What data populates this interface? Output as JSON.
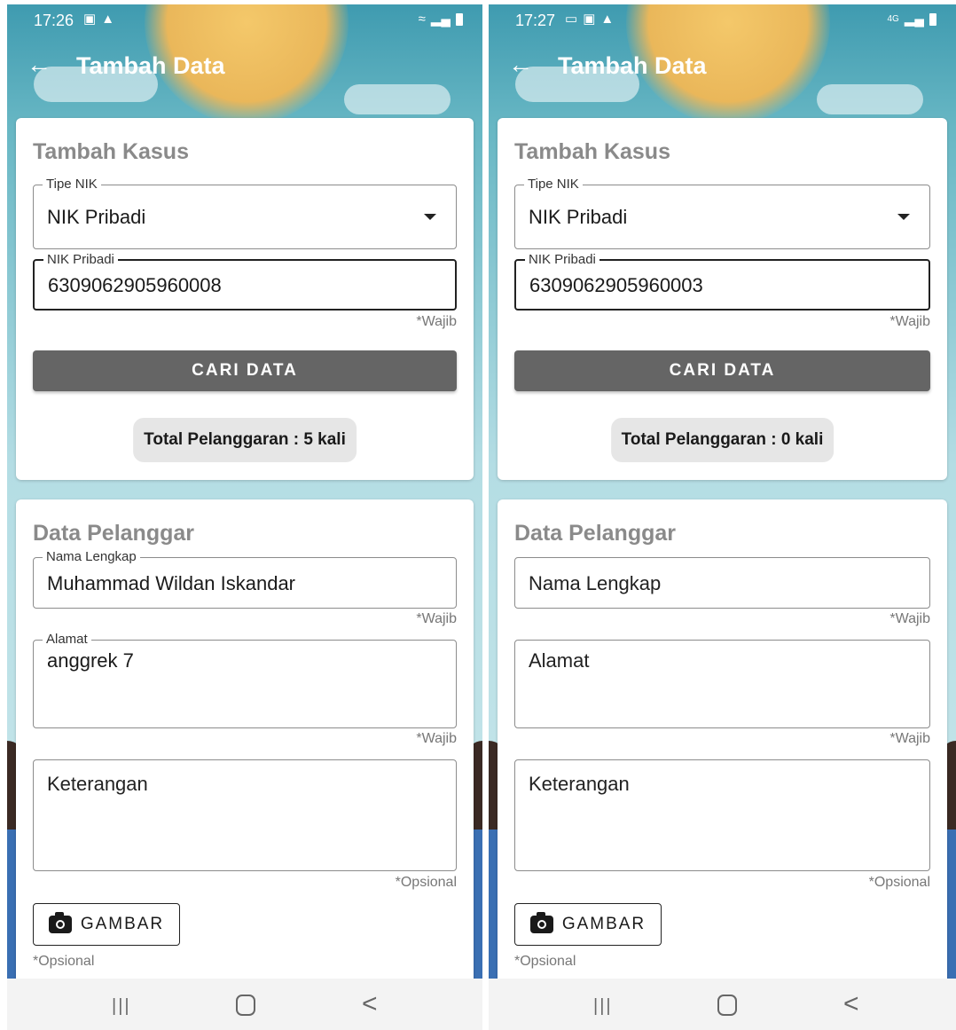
{
  "screens": [
    {
      "status": {
        "time": "17:26",
        "icons_left": [
          "image-icon",
          "warning-icon"
        ],
        "icons_right": [
          "wifi-icon",
          "signal-icon",
          "battery-icon"
        ]
      },
      "appbar": {
        "title": "Tambah Data"
      },
      "case_card": {
        "title": "Tambah Kasus",
        "nik_type": {
          "label": "Tipe NIK",
          "value": "NIK Pribadi"
        },
        "nik": {
          "label": "NIK Pribadi",
          "value": "6309062905960008",
          "hint": "*Wajib"
        },
        "search_button": "CARI DATA",
        "violation_total": "Total Pelanggaran : 5 kali"
      },
      "customer_card": {
        "title": "Data Pelanggar",
        "full_name": {
          "label": "Nama Lengkap",
          "value": "Muhammad Wildan Iskandar",
          "hint": "*Wajib"
        },
        "address": {
          "label": "Alamat",
          "value": "anggrek 7",
          "hint": "*Wajib"
        },
        "notes": {
          "placeholder": "Keterangan",
          "hint": "*Opsional"
        },
        "image_button": "GAMBAR",
        "image_hint": "*Opsional"
      },
      "navbar": {
        "recent": "|||",
        "back": "<"
      }
    },
    {
      "status": {
        "time": "17:27",
        "icons_left": [
          "laptop-icon",
          "image-icon",
          "warning-icon"
        ],
        "network": "4G",
        "icons_right": [
          "signal-icon",
          "battery-icon"
        ]
      },
      "appbar": {
        "title": "Tambah Data"
      },
      "case_card": {
        "title": "Tambah Kasus",
        "nik_type": {
          "label": "Tipe NIK",
          "value": "NIK Pribadi"
        },
        "nik": {
          "label": "NIK Pribadi",
          "value": "6309062905960003",
          "hint": "*Wajib"
        },
        "search_button": "CARI DATA",
        "violation_total": "Total Pelanggaran : 0 kali"
      },
      "customer_card": {
        "title": "Data Pelanggar",
        "full_name": {
          "placeholder": "Nama Lengkap",
          "hint": "*Wajib"
        },
        "address": {
          "placeholder": "Alamat",
          "hint": "*Wajib"
        },
        "notes": {
          "placeholder": "Keterangan",
          "hint": "*Opsional"
        },
        "image_button": "GAMBAR",
        "image_hint": "*Opsional"
      },
      "navbar": {
        "recent": "|||",
        "back": "<"
      }
    }
  ]
}
